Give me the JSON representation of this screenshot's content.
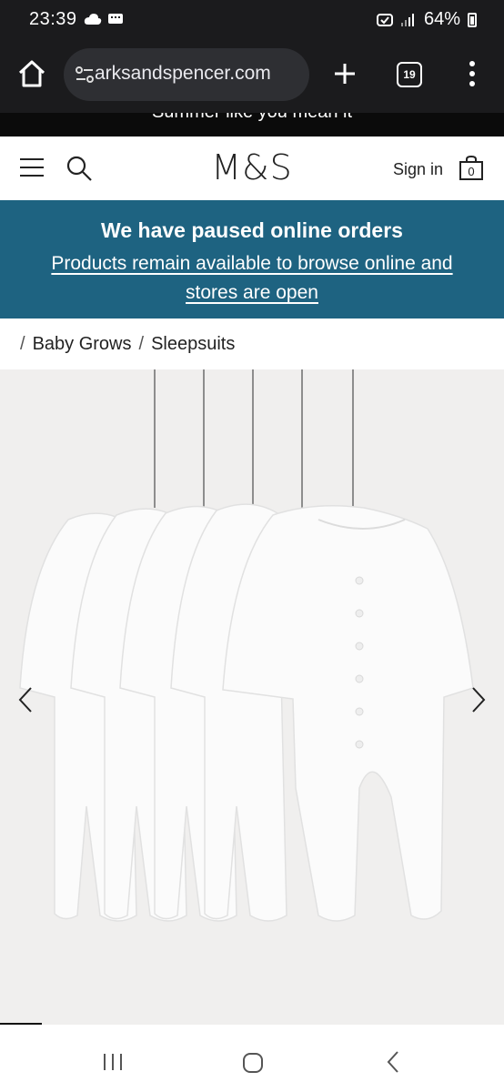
{
  "status_bar": {
    "time": "23:39",
    "battery": "64%"
  },
  "browser": {
    "url": "arksandspencer.com",
    "tab_count": "19"
  },
  "promo": {
    "text": "Summer like you mean it"
  },
  "site_header": {
    "logo": "M&S",
    "sign_in": "Sign in",
    "bag_count": "0"
  },
  "notice": {
    "title": "We have paused online orders",
    "link": "Products remain available to browse online and stores are open"
  },
  "breadcrumb": {
    "items": [
      "Baby Grows",
      "Sleepsuits"
    ]
  },
  "gallery": {
    "progress_fraction": 0.083
  },
  "colors": {
    "banner": "#1e6381",
    "chrome": "#1b1b1d"
  }
}
